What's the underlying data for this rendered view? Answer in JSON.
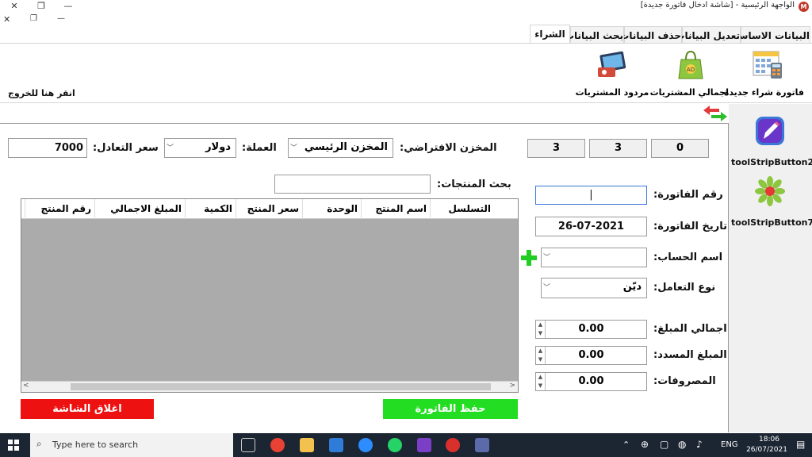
{
  "window": {
    "title": "الواجهة الرئيسية - [شاشة ادخال فاتورة جديدة]",
    "app_icon_letter": "M",
    "minimize": "—",
    "restore": "❐",
    "close": "✕"
  },
  "tabs": [
    "البيانات الاساسية",
    "تعديل البيانات",
    "حذف البيانات",
    "بحث البيانات",
    "الشراء"
  ],
  "ribbon": {
    "buttons": [
      {
        "label": "فاتورة شراء جديدة",
        "icon": "calculator-icon"
      },
      {
        "label": "اجمالي المشتريات",
        "icon": "shopping-bag-icon"
      },
      {
        "label": "مردود المشتريات",
        "icon": "returns-icon"
      }
    ],
    "exit_label": "انقر هنا للخروج"
  },
  "side_toolbar": {
    "buttons": [
      {
        "label": "toolStripButton2",
        "icon": "edit-icon"
      },
      {
        "label": "toolStripButton7",
        "icon": "flower-icon"
      }
    ]
  },
  "form": {
    "counters": [
      "0",
      "3",
      "3"
    ],
    "warehouse_label": "المخزن الافتراضي:",
    "warehouse_value": "المخزن الرئيسي",
    "currency_label": "العملة:",
    "currency_value": "دولار",
    "exchange_label": "سعر التعادل:",
    "exchange_value": "7000",
    "product_search_label": "بحث المنتجات:",
    "product_search_value": "",
    "invoice_no_label": "رقم الفاتورة:",
    "invoice_no_value": "|",
    "invoice_date_label": "تاريخ الفاتورة:",
    "invoice_date_value": "26-07-2021",
    "account_label": "اسم الحساب:",
    "account_value": "",
    "deal_type_label": "نوع التعامل:",
    "deal_type_value": "ديّن",
    "total_label": "اجمالي المبلغ:",
    "total_value": "0.00",
    "paid_label": "المبلغ المسدد:",
    "paid_value": "0.00",
    "expenses_label": "المصروفات:",
    "expenses_value": "0.00"
  },
  "grid": {
    "columns": [
      "التسلسل",
      "اسم المنتج",
      "الوحدة",
      "سعر المنتج",
      "الكمية",
      "المبلغ الاجمالي",
      "رقم المنتج"
    ]
  },
  "actions": {
    "save_label": "حفظ الفاتورة",
    "close_label": "اغلاق الشاشة",
    "save_color": "#22dd22",
    "close_color": "#ee1111"
  },
  "taskbar": {
    "search_placeholder": "Type here to search",
    "language": "ENG",
    "time": "18:06",
    "date": "26/07/2021"
  },
  "colors": {
    "grid_background": "#ababab",
    "add_plus": "#22cc22"
  }
}
